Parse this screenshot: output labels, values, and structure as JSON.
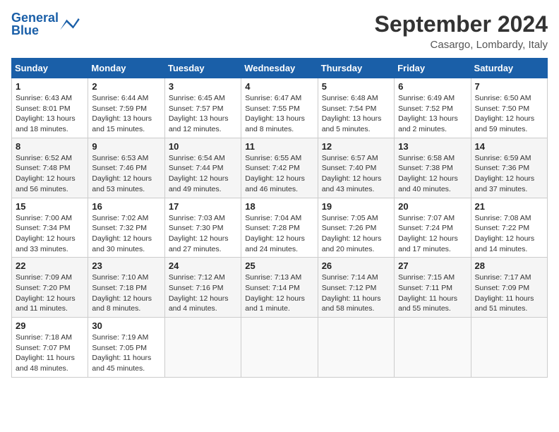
{
  "header": {
    "logo_general": "General",
    "logo_blue": "Blue",
    "month_title": "September 2024",
    "location": "Casargo, Lombardy, Italy"
  },
  "columns": [
    "Sunday",
    "Monday",
    "Tuesday",
    "Wednesday",
    "Thursday",
    "Friday",
    "Saturday"
  ],
  "weeks": [
    [
      {
        "day": "1",
        "sunrise": "Sunrise: 6:43 AM",
        "sunset": "Sunset: 8:01 PM",
        "daylight": "Daylight: 13 hours and 18 minutes."
      },
      {
        "day": "2",
        "sunrise": "Sunrise: 6:44 AM",
        "sunset": "Sunset: 7:59 PM",
        "daylight": "Daylight: 13 hours and 15 minutes."
      },
      {
        "day": "3",
        "sunrise": "Sunrise: 6:45 AM",
        "sunset": "Sunset: 7:57 PM",
        "daylight": "Daylight: 13 hours and 12 minutes."
      },
      {
        "day": "4",
        "sunrise": "Sunrise: 6:47 AM",
        "sunset": "Sunset: 7:55 PM",
        "daylight": "Daylight: 13 hours and 8 minutes."
      },
      {
        "day": "5",
        "sunrise": "Sunrise: 6:48 AM",
        "sunset": "Sunset: 7:54 PM",
        "daylight": "Daylight: 13 hours and 5 minutes."
      },
      {
        "day": "6",
        "sunrise": "Sunrise: 6:49 AM",
        "sunset": "Sunset: 7:52 PM",
        "daylight": "Daylight: 13 hours and 2 minutes."
      },
      {
        "day": "7",
        "sunrise": "Sunrise: 6:50 AM",
        "sunset": "Sunset: 7:50 PM",
        "daylight": "Daylight: 12 hours and 59 minutes."
      }
    ],
    [
      {
        "day": "8",
        "sunrise": "Sunrise: 6:52 AM",
        "sunset": "Sunset: 7:48 PM",
        "daylight": "Daylight: 12 hours and 56 minutes."
      },
      {
        "day": "9",
        "sunrise": "Sunrise: 6:53 AM",
        "sunset": "Sunset: 7:46 PM",
        "daylight": "Daylight: 12 hours and 53 minutes."
      },
      {
        "day": "10",
        "sunrise": "Sunrise: 6:54 AM",
        "sunset": "Sunset: 7:44 PM",
        "daylight": "Daylight: 12 hours and 49 minutes."
      },
      {
        "day": "11",
        "sunrise": "Sunrise: 6:55 AM",
        "sunset": "Sunset: 7:42 PM",
        "daylight": "Daylight: 12 hours and 46 minutes."
      },
      {
        "day": "12",
        "sunrise": "Sunrise: 6:57 AM",
        "sunset": "Sunset: 7:40 PM",
        "daylight": "Daylight: 12 hours and 43 minutes."
      },
      {
        "day": "13",
        "sunrise": "Sunrise: 6:58 AM",
        "sunset": "Sunset: 7:38 PM",
        "daylight": "Daylight: 12 hours and 40 minutes."
      },
      {
        "day": "14",
        "sunrise": "Sunrise: 6:59 AM",
        "sunset": "Sunset: 7:36 PM",
        "daylight": "Daylight: 12 hours and 37 minutes."
      }
    ],
    [
      {
        "day": "15",
        "sunrise": "Sunrise: 7:00 AM",
        "sunset": "Sunset: 7:34 PM",
        "daylight": "Daylight: 12 hours and 33 minutes."
      },
      {
        "day": "16",
        "sunrise": "Sunrise: 7:02 AM",
        "sunset": "Sunset: 7:32 PM",
        "daylight": "Daylight: 12 hours and 30 minutes."
      },
      {
        "day": "17",
        "sunrise": "Sunrise: 7:03 AM",
        "sunset": "Sunset: 7:30 PM",
        "daylight": "Daylight: 12 hours and 27 minutes."
      },
      {
        "day": "18",
        "sunrise": "Sunrise: 7:04 AM",
        "sunset": "Sunset: 7:28 PM",
        "daylight": "Daylight: 12 hours and 24 minutes."
      },
      {
        "day": "19",
        "sunrise": "Sunrise: 7:05 AM",
        "sunset": "Sunset: 7:26 PM",
        "daylight": "Daylight: 12 hours and 20 minutes."
      },
      {
        "day": "20",
        "sunrise": "Sunrise: 7:07 AM",
        "sunset": "Sunset: 7:24 PM",
        "daylight": "Daylight: 12 hours and 17 minutes."
      },
      {
        "day": "21",
        "sunrise": "Sunrise: 7:08 AM",
        "sunset": "Sunset: 7:22 PM",
        "daylight": "Daylight: 12 hours and 14 minutes."
      }
    ],
    [
      {
        "day": "22",
        "sunrise": "Sunrise: 7:09 AM",
        "sunset": "Sunset: 7:20 PM",
        "daylight": "Daylight: 12 hours and 11 minutes."
      },
      {
        "day": "23",
        "sunrise": "Sunrise: 7:10 AM",
        "sunset": "Sunset: 7:18 PM",
        "daylight": "Daylight: 12 hours and 8 minutes."
      },
      {
        "day": "24",
        "sunrise": "Sunrise: 7:12 AM",
        "sunset": "Sunset: 7:16 PM",
        "daylight": "Daylight: 12 hours and 4 minutes."
      },
      {
        "day": "25",
        "sunrise": "Sunrise: 7:13 AM",
        "sunset": "Sunset: 7:14 PM",
        "daylight": "Daylight: 12 hours and 1 minute."
      },
      {
        "day": "26",
        "sunrise": "Sunrise: 7:14 AM",
        "sunset": "Sunset: 7:12 PM",
        "daylight": "Daylight: 11 hours and 58 minutes."
      },
      {
        "day": "27",
        "sunrise": "Sunrise: 7:15 AM",
        "sunset": "Sunset: 7:11 PM",
        "daylight": "Daylight: 11 hours and 55 minutes."
      },
      {
        "day": "28",
        "sunrise": "Sunrise: 7:17 AM",
        "sunset": "Sunset: 7:09 PM",
        "daylight": "Daylight: 11 hours and 51 minutes."
      }
    ],
    [
      {
        "day": "29",
        "sunrise": "Sunrise: 7:18 AM",
        "sunset": "Sunset: 7:07 PM",
        "daylight": "Daylight: 11 hours and 48 minutes."
      },
      {
        "day": "30",
        "sunrise": "Sunrise: 7:19 AM",
        "sunset": "Sunset: 7:05 PM",
        "daylight": "Daylight: 11 hours and 45 minutes."
      },
      null,
      null,
      null,
      null,
      null
    ]
  ]
}
